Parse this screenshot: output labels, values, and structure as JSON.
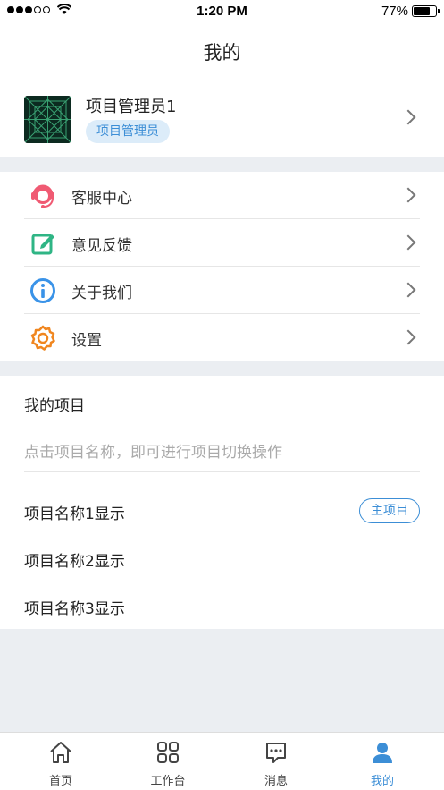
{
  "status_bar": {
    "time": "1:20 PM",
    "battery_text": "77%",
    "battery_level": 0.77
  },
  "header": {
    "title": "我的"
  },
  "profile": {
    "name": "项目管理员1",
    "role": "项目管理员"
  },
  "menu": {
    "items": [
      {
        "label": "客服中心",
        "icon": "customer-service-icon",
        "color": "#f05a73"
      },
      {
        "label": "意见反馈",
        "icon": "feedback-edit-icon",
        "color": "#2fb585"
      },
      {
        "label": "关于我们",
        "icon": "info-icon",
        "color": "#3a93e8"
      },
      {
        "label": "设置",
        "icon": "gear-icon",
        "color": "#f0861f"
      }
    ]
  },
  "projects": {
    "title": "我的项目",
    "hint": "点击项目名称，即可进行项目切换操作",
    "items": [
      {
        "name": "项目名称1显示",
        "badge": "主项目"
      },
      {
        "name": "项目名称2显示"
      },
      {
        "name": "项目名称3显示"
      }
    ]
  },
  "tabbar": {
    "active": "我的",
    "accent": "#3c8ed6",
    "tabs": [
      {
        "label": "首页",
        "icon": "home-icon"
      },
      {
        "label": "工作台",
        "icon": "workbench-grid-icon"
      },
      {
        "label": "消息",
        "icon": "message-icon"
      },
      {
        "label": "我的",
        "icon": "user-icon"
      }
    ]
  }
}
